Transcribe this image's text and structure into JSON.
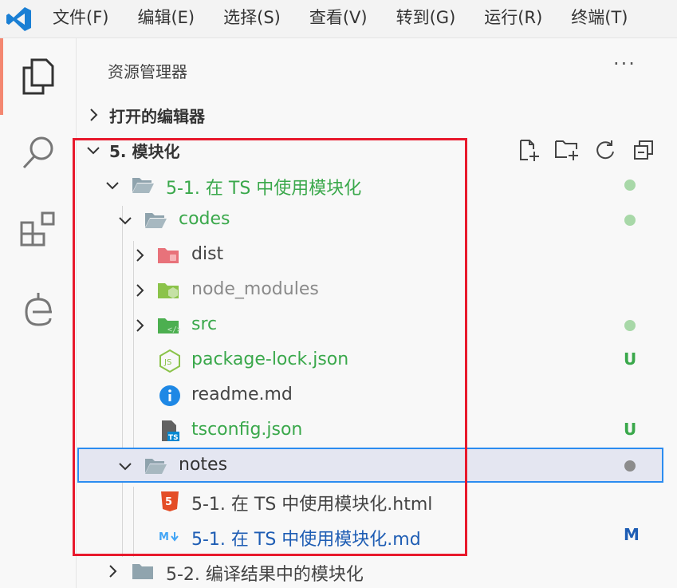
{
  "menu": [
    "文件(F)",
    "编辑(E)",
    "选择(S)",
    "查看(V)",
    "转到(G)",
    "运行(R)",
    "终端(T)"
  ],
  "sidebar": {
    "title": "资源管理器",
    "more": "···",
    "open_editors": "打开的编辑器",
    "workspace": "5. 模块化"
  },
  "tree": [
    {
      "name": "5-1. 在 TS 中使用模块化",
      "color": "#3aa84b",
      "status": "dot",
      "dot_color": "#a8d8a8",
      "icon": "folder-open-icon",
      "expanded": true
    },
    {
      "name": "codes",
      "color": "#3aa84b",
      "status": "dot",
      "dot_color": "#a8d8a8",
      "icon": "folder-open-icon",
      "expanded": true
    },
    {
      "name": "dist",
      "color": "#444444",
      "status": "",
      "icon": "dist-folder-icon",
      "expanded": false
    },
    {
      "name": "node_modules",
      "color": "#8a8a8a",
      "status": "",
      "icon": "node-folder-icon",
      "expanded": false
    },
    {
      "name": "src",
      "color": "#3aa84b",
      "status": "dot",
      "dot_color": "#a8d8a8",
      "icon": "src-folder-icon",
      "expanded": false
    },
    {
      "name": "package-lock.json",
      "color": "#3aa84b",
      "status": "U",
      "status_color": "#3aa84b",
      "icon": "nodejs-file-icon"
    },
    {
      "name": "readme.md",
      "color": "#444444",
      "status": "",
      "icon": "info-file-icon"
    },
    {
      "name": "tsconfig.json",
      "color": "#3aa84b",
      "status": "U",
      "status_color": "#3aa84b",
      "icon": "tsconfig-file-icon"
    },
    {
      "name": "notes",
      "color": "#333333",
      "status": "dot",
      "dot_color": "#8c8c8c",
      "icon": "folder-open-icon",
      "expanded": true
    },
    {
      "name": "5-1. 在 TS 中使用模块化.html",
      "color": "#444444",
      "status": "",
      "icon": "html5-file-icon"
    },
    {
      "name": "5-1. 在 TS 中使用模块化.md",
      "color": "#1e5db4",
      "status": "M",
      "status_color": "#1e5db4",
      "icon": "markdown-file-icon"
    },
    {
      "name": "5-2. 编译结果中的模块化",
      "color": "#444444",
      "status": "",
      "icon": "folder-closed-icon",
      "expanded": false
    }
  ]
}
